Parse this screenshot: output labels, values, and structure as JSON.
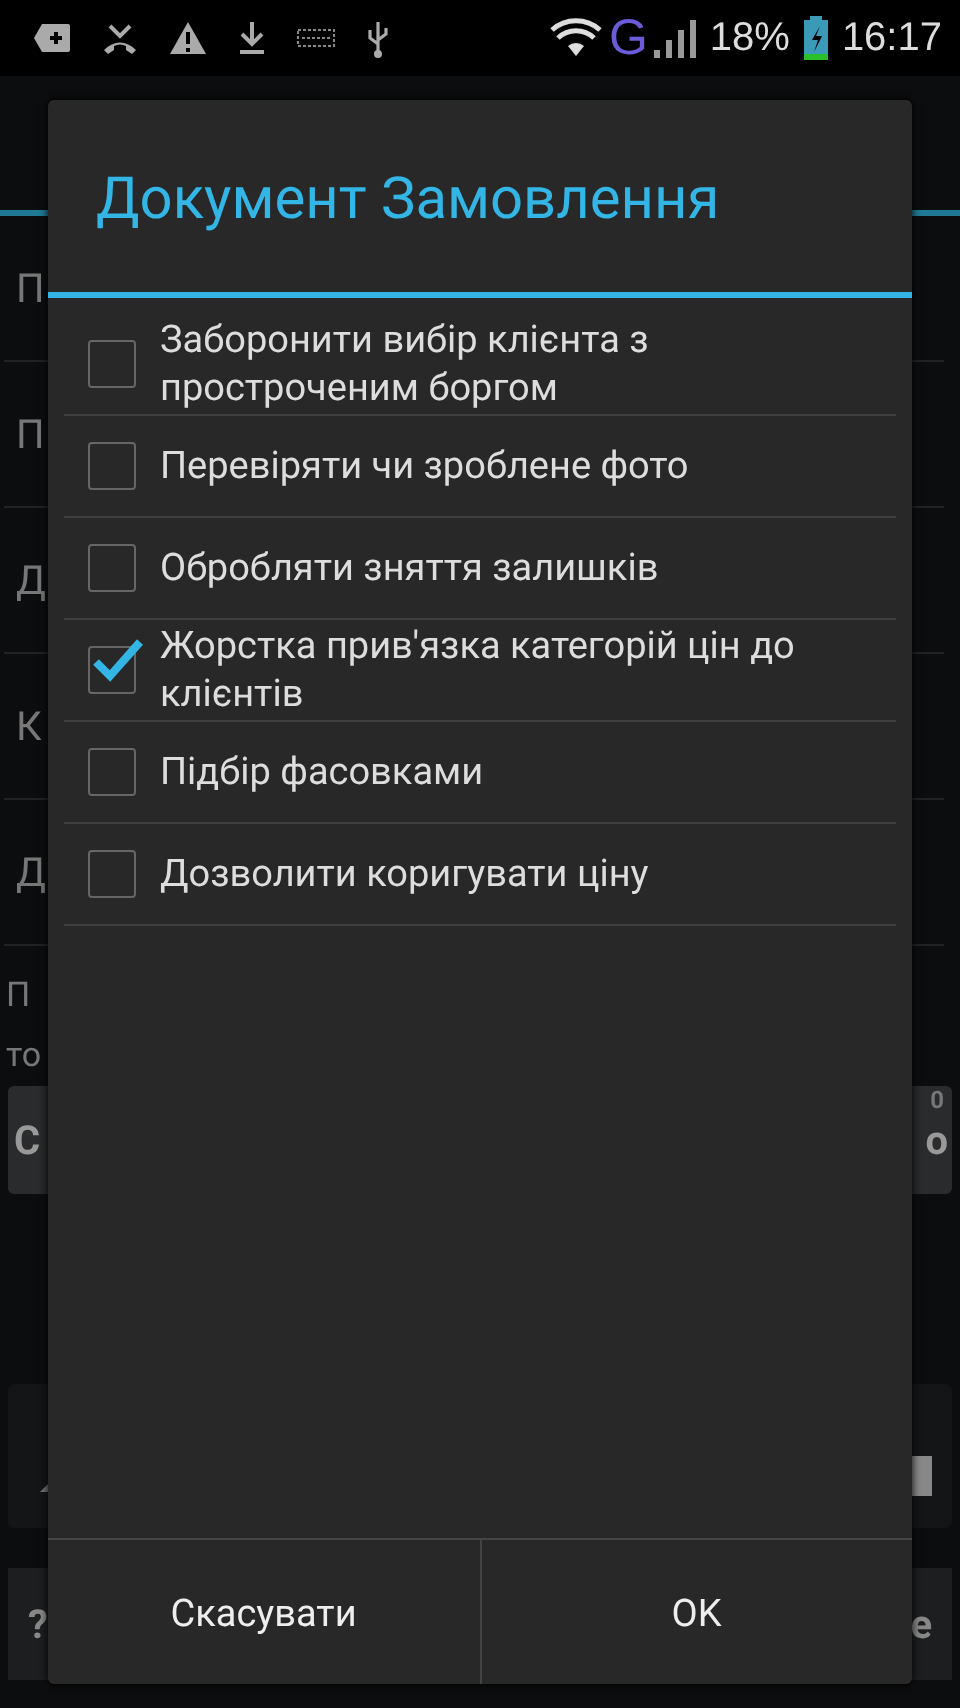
{
  "status_bar": {
    "network": "G",
    "battery": "18%",
    "time": "16:17"
  },
  "background": {
    "rows": [
      {
        "left": "П"
      },
      {
        "left": "П"
      },
      {
        "left": "Д"
      },
      {
        "left": "К"
      },
      {
        "left": "Д"
      }
    ],
    "note_lines": [
      "П",
      "то"
    ],
    "wide_button": {
      "left": "С",
      "right": "о",
      "badge": "0"
    },
    "bottom_buttons": [
      {
        "label": "?"
      },
      {
        "label": "е"
      }
    ]
  },
  "dialog": {
    "title": "Документ Замовлення",
    "options": [
      {
        "label": "Заборонити вибір клієнта з простроченим боргом",
        "checked": false
      },
      {
        "label": "Перевіряти чи зроблене фото",
        "checked": false
      },
      {
        "label": "Обробляти зняття залишків",
        "checked": false
      },
      {
        "label": "Жорстка прив'язка категорій цін до клієнтів",
        "checked": true
      },
      {
        "label": "Підбір фасовками",
        "checked": false
      },
      {
        "label": "Дозволити коригувати ціну",
        "checked": false
      }
    ],
    "buttons": [
      {
        "label": "Скасувати"
      },
      {
        "label": "OK"
      }
    ]
  }
}
